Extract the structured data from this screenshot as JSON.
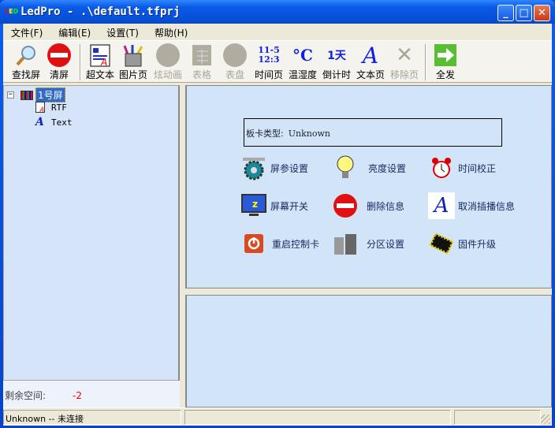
{
  "window": {
    "title": "LedPro - .\\default.tfprj",
    "app_icon_text": "LED"
  },
  "menu": [
    "文件(F)",
    "编辑(E)",
    "设置(T)",
    "帮助(H)"
  ],
  "toolbar": [
    {
      "label": "查找屏",
      "icon": "magnifier-icon",
      "enabled": true
    },
    {
      "label": "清屏",
      "icon": "no-entry-icon",
      "enabled": true
    },
    {
      "label": "超文本",
      "icon": "rtf-document-icon",
      "enabled": true
    },
    {
      "label": "图片页",
      "icon": "pencil-cup-icon",
      "enabled": true
    },
    {
      "label": "炫动画",
      "icon": "animation-icon",
      "enabled": false
    },
    {
      "label": "表格",
      "icon": "table-icon",
      "enabled": false
    },
    {
      "label": "表盘",
      "icon": "clock-dial-icon",
      "enabled": false
    },
    {
      "label": "时间页",
      "icon": "time-icon",
      "enabled": true,
      "glyph": "11-5\n12:3"
    },
    {
      "label": "温湿度",
      "icon": "celsius-icon",
      "enabled": true,
      "glyph": "°C"
    },
    {
      "label": "倒计时",
      "icon": "countdown-icon",
      "enabled": true,
      "glyph": "1天"
    },
    {
      "label": "文本页",
      "icon": "text-a-icon",
      "enabled": true,
      "glyph": "A"
    },
    {
      "label": "移除页",
      "icon": "remove-x-icon",
      "enabled": false
    },
    {
      "label": "全发",
      "icon": "send-arrow-icon",
      "enabled": true
    }
  ],
  "tree": {
    "root": "1号屏",
    "children": [
      "RTF",
      "Text"
    ]
  },
  "remaining": {
    "label": "剩余空间:",
    "value": "-2"
  },
  "card": {
    "label": "板卡类型:",
    "value": "Unknown"
  },
  "actions": [
    "屏参设置",
    "亮度设置",
    "时间校正",
    "屏幕开关",
    "删除信息",
    "取消插播信息",
    "重启控制卡",
    "分区设置",
    "固件升级"
  ],
  "status": {
    "connection": "Unknown -- 未连接"
  },
  "colors": {
    "titlebar": "#0a5ae6",
    "panel": "#d2e4f8",
    "accent_red": "#ff0000"
  }
}
